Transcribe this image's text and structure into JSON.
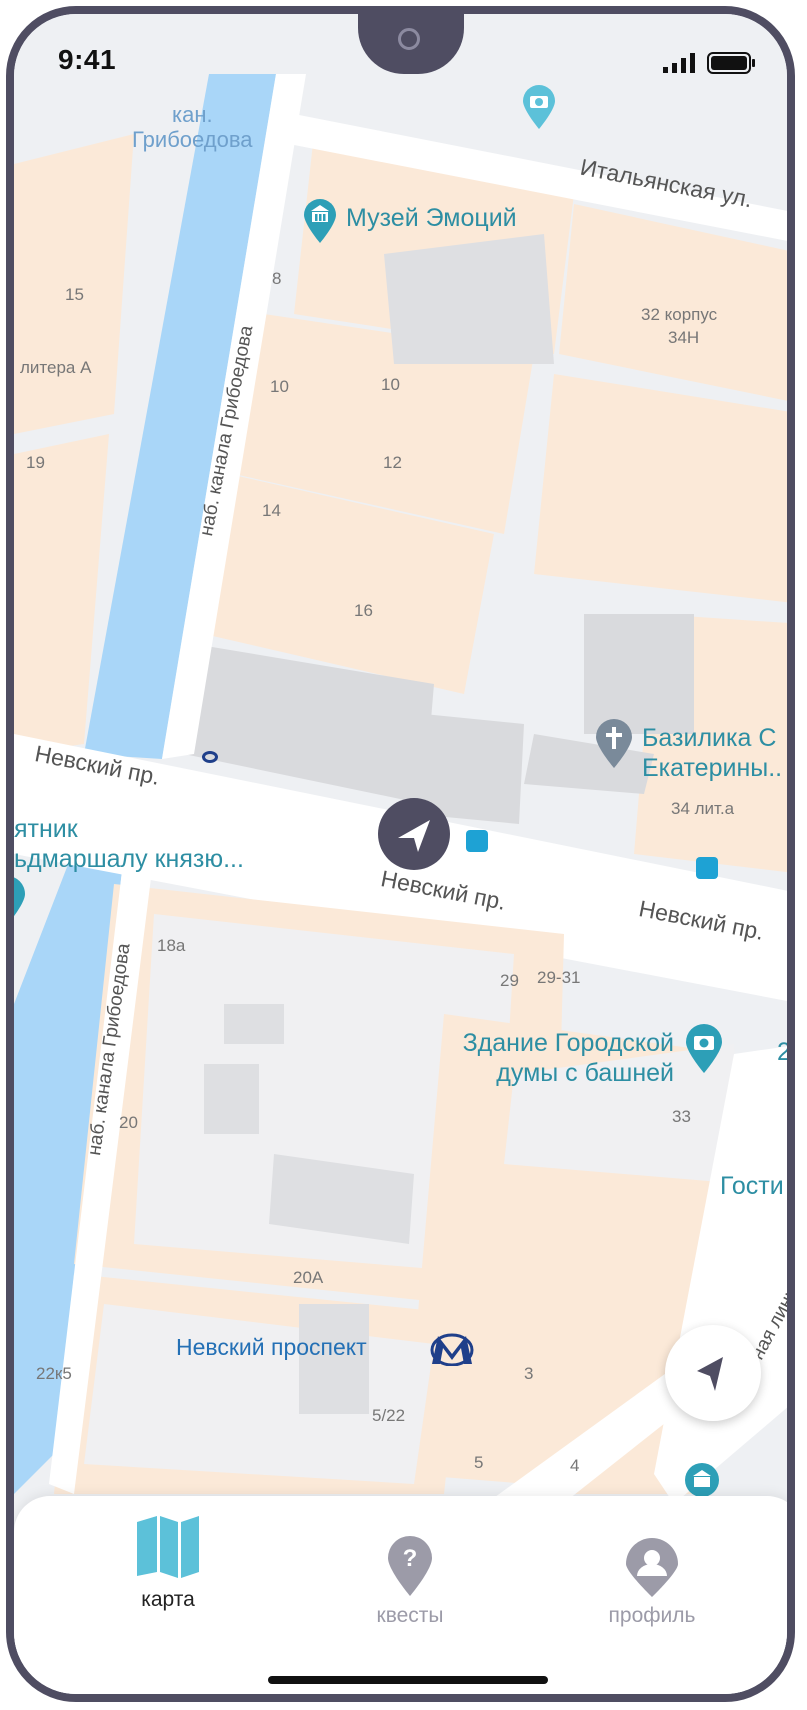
{
  "status_bar": {
    "time": "9:41"
  },
  "map": {
    "canal_label": "кан.\nГрибоедова",
    "streets": {
      "italyanskaya": "Итальянская ул.",
      "nevsky_left": "Невский пр.",
      "nevsky_mid": "Невский пр.",
      "nevsky_right": "Невский пр.",
      "embankment_top": "наб. канала Грибоедова",
      "embankment_bottom": "наб. канала Грибоедова",
      "liniya": "ная линия"
    },
    "house_numbers": {
      "n15": "15",
      "litera_a": "литера А",
      "n19": "19",
      "n8": "8",
      "n10a": "10",
      "n10b": "10",
      "n12": "12",
      "n14": "14",
      "n16": "16",
      "korpus": "32 корпус",
      "n34n": "34Н",
      "n34lit": "34 лит.а",
      "n18a": "18а",
      "n29": "29",
      "n29_31": "29-31",
      "n20": "20",
      "n33": "33",
      "n20a": "20А",
      "n22k5": "22к5",
      "n3": "3",
      "n5_22": "5/22",
      "n5": "5",
      "n4": "4",
      "n2": "2"
    },
    "pois": {
      "museum": "Музей Эмоций",
      "basilica": "Базилика С\nЕкатерины..",
      "monument": "ятник\nьдмаршалу князю...",
      "duma": "Здание Городской\nдумы с башней",
      "gostiny": "Гости",
      "metro": "Невский проспект"
    }
  },
  "bottom_nav": {
    "tabs": [
      {
        "label": "карта",
        "icon": "map-icon",
        "active": true
      },
      {
        "label": "квесты",
        "icon": "quest-pin-icon",
        "active": false
      },
      {
        "label": "профиль",
        "icon": "profile-pin-icon",
        "active": false
      }
    ]
  },
  "colors": {
    "frame": "#4f4d62",
    "accent": "#5cc1d9",
    "map_block": "#fbe9d8",
    "canal": "#a9d6f8",
    "poi_text": "#2d8ea3",
    "inactive_tab": "#9c9ba8"
  }
}
